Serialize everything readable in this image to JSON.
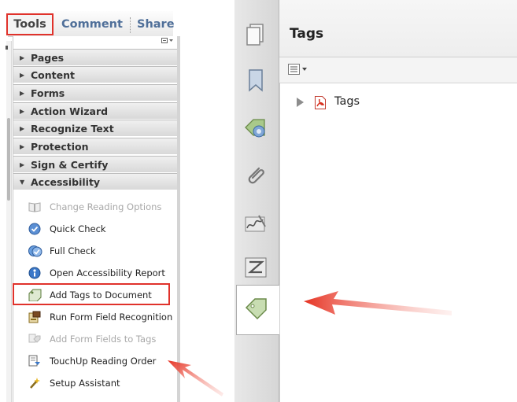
{
  "toolbar": {
    "tools_label": "Tools",
    "comment_label": "Comment",
    "share_label": "Share"
  },
  "sections": [
    {
      "label": "Pages",
      "expanded": false
    },
    {
      "label": "Content",
      "expanded": false
    },
    {
      "label": "Forms",
      "expanded": false
    },
    {
      "label": "Action Wizard",
      "expanded": false
    },
    {
      "label": "Recognize Text",
      "expanded": false
    },
    {
      "label": "Protection",
      "expanded": false
    },
    {
      "label": "Sign & Certify",
      "expanded": false
    },
    {
      "label": "Accessibility",
      "expanded": true
    }
  ],
  "accessibility_items": [
    {
      "label": "Change Reading Options",
      "enabled": false,
      "icon": "book-icon"
    },
    {
      "label": "Quick Check",
      "enabled": true,
      "icon": "checkmark-circle-icon"
    },
    {
      "label": "Full Check",
      "enabled": true,
      "icon": "double-check-icon"
    },
    {
      "label": "Open Accessibility Report",
      "enabled": true,
      "icon": "report-globe-icon"
    },
    {
      "label": "Add Tags to Document",
      "enabled": true,
      "icon": "tag-document-icon"
    },
    {
      "label": "Run Form Field Recognition",
      "enabled": true,
      "icon": "form-field-icon"
    },
    {
      "label": "Add Form Fields to Tags",
      "enabled": false,
      "icon": "form-tag-icon"
    },
    {
      "label": "TouchUp Reading Order",
      "enabled": true,
      "icon": "reading-order-icon"
    },
    {
      "label": "Setup Assistant",
      "enabled": true,
      "icon": "wand-icon"
    }
  ],
  "tags_panel": {
    "title": "Tags",
    "tree_root_label": "Tags"
  },
  "colors": {
    "highlight": "#e0322b",
    "arrow": "#e63323",
    "link_blue": "#4f6f99"
  }
}
